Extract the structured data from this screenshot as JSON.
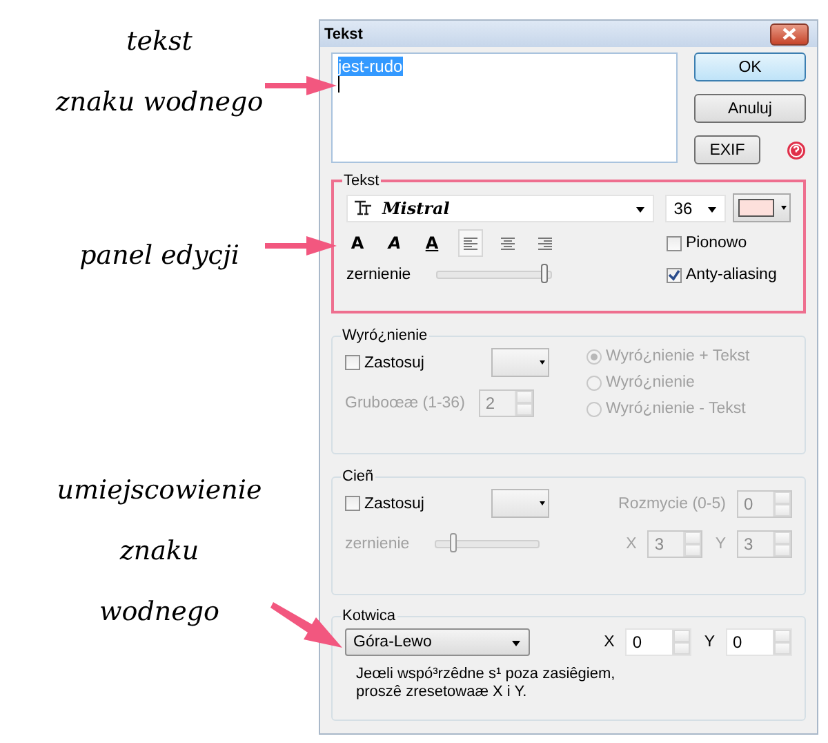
{
  "annotations": [
    {
      "lines": [
        "tekst",
        "znaku wodnego"
      ]
    },
    {
      "lines": [
        "panel edycji"
      ]
    },
    {
      "lines": [
        "umiejscowienie",
        "znaku",
        "wodnego"
      ]
    }
  ],
  "window": {
    "title": "Tekst"
  },
  "text_area": {
    "value": "jest-rudo"
  },
  "buttons": [
    {
      "label": "OK",
      "default": true
    },
    {
      "label": "Anuluj",
      "default": false
    },
    {
      "label": "EXIF",
      "default": false
    }
  ],
  "text_group": {
    "title": "Tekst",
    "font": "Mistral",
    "size": "36",
    "color": "#fde0dc",
    "styles": [
      {
        "kind": "bold",
        "label": "A"
      },
      {
        "kind": "italic",
        "label": "A"
      },
      {
        "kind": "underline",
        "label": "A"
      }
    ],
    "alignments": [
      {
        "kind": "left",
        "selected": true
      },
      {
        "kind": "center",
        "selected": false
      },
      {
        "kind": "right",
        "selected": false
      }
    ],
    "vertical": {
      "label": "Pionowo",
      "checked": false
    },
    "blur": {
      "label": "zernienie",
      "level": 0.97
    },
    "antialias": {
      "label": "Anty-aliasing",
      "checked": true
    }
  },
  "highlight": {
    "title": "Wyró¿nienie",
    "enabled": false,
    "apply": {
      "label": "Zastosuj",
      "checked": false
    },
    "thickness": {
      "label": "Gruboœæ (1-36)",
      "value": "2"
    },
    "modes": [
      {
        "label": "Wyró¿nienie + Tekst",
        "selected": true
      },
      {
        "label": "Wyró¿nienie",
        "selected": false
      },
      {
        "label": "Wyró¿nienie - Tekst",
        "selected": false
      }
    ]
  },
  "shadow": {
    "title": "Cieñ",
    "enabled": false,
    "apply": {
      "label": "Zastosuj",
      "checked": false
    },
    "blur": {
      "label": "Rozmycie (0-5)",
      "value": "0"
    },
    "strength": {
      "label": "zernienie",
      "level": 0.2
    },
    "x": {
      "label": "X",
      "value": "3"
    },
    "y": {
      "label": "Y",
      "value": "3"
    }
  },
  "anchor": {
    "title": "Kotwica",
    "position": "Góra-Lewo",
    "x": {
      "label": "X",
      "value": "0"
    },
    "y": {
      "label": "Y",
      "value": "0"
    },
    "note": [
      "Jeœli wspó³rzêdne s¹ poza zasiêgiem,",
      "proszê zresetowaæ X i Y."
    ]
  }
}
